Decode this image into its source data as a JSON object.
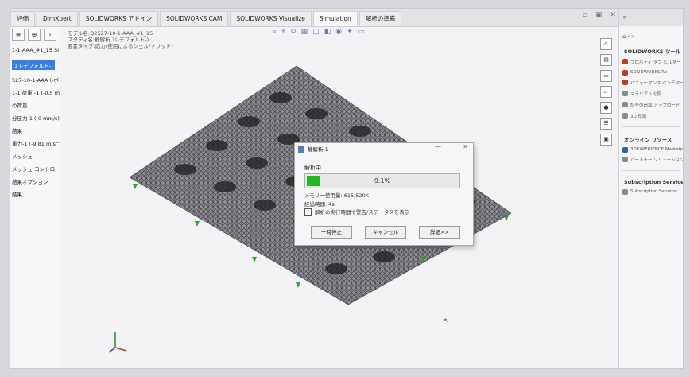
{
  "tabs": [
    {
      "label": "評価"
    },
    {
      "label": "DimXpert"
    },
    {
      "label": "SOLIDWORKS アドイン"
    },
    {
      "label": "SOLIDWORKS CAM"
    },
    {
      "label": "SOLIDWORKS Visualize"
    },
    {
      "label": "Simulation"
    },
    {
      "label": "解析の準備"
    }
  ],
  "model_info": {
    "line1": "モデル名:Q2527-10-1-AAA_#1_15",
    "line2": "スタディ名:静解析 1(-デフォルト-)",
    "line3": "要素タイプ:応力(使用によるシェル/ソリッド)"
  },
  "left_panel": {
    "items": [
      "1-1-AAA_#1_15 SI",
      "1 (-デフォルト-)",
      "527-10-1-AAA (-ボリューム-)",
      "1-1 荷重:-1 (-0.5 mm/1",
      "の荷重",
      "分圧力-1 (-0 mm/s)",
      "結果",
      "重力-1 (-9.81 m/s^2-)",
      "メッシュ",
      "メッシュ コントロール",
      "結果オプション",
      "結果"
    ],
    "selected": "1 (-デフォルト-)"
  },
  "dialog": {
    "title": "静解析 1",
    "status": "解析中",
    "progress_text": "9.1%",
    "progress_fraction": 0.091,
    "memory": "メモリー使用量: 615,520K",
    "elapsed": "経過時間: 4s",
    "checkbox_label": "解析の実行時間で警告/ステータスを表示",
    "checkbox_checked": true,
    "buttons": {
      "pause": "一時停止",
      "cancel": "キャンセル",
      "details": "詳細>>"
    }
  },
  "task_pane": {
    "title": "SOLIDWORKS ツール",
    "tools": [
      {
        "label": "プロパティ タブ ビルダー",
        "color": "red"
      },
      {
        "label": "SOLIDWORKS Rx",
        "color": "red"
      },
      {
        "label": "パフォーマンス ベンチマーク",
        "color": "red"
      },
      {
        "label": "マテリアル比較",
        "color": "gray"
      },
      {
        "label": "記号の追加/アップロード",
        "color": "gray"
      },
      {
        "label": "3D 印刷",
        "color": "gray"
      }
    ],
    "online_title": "オンライン リソース",
    "online": [
      {
        "label": "3DEXPERIENCE Marketplace",
        "color": "blue"
      },
      {
        "label": "パートナー ソリューション",
        "color": "gray"
      }
    ],
    "subscription_title": "Subscription Services",
    "subscription": [
      {
        "label": "Subscription Services",
        "color": "gray"
      }
    ]
  }
}
